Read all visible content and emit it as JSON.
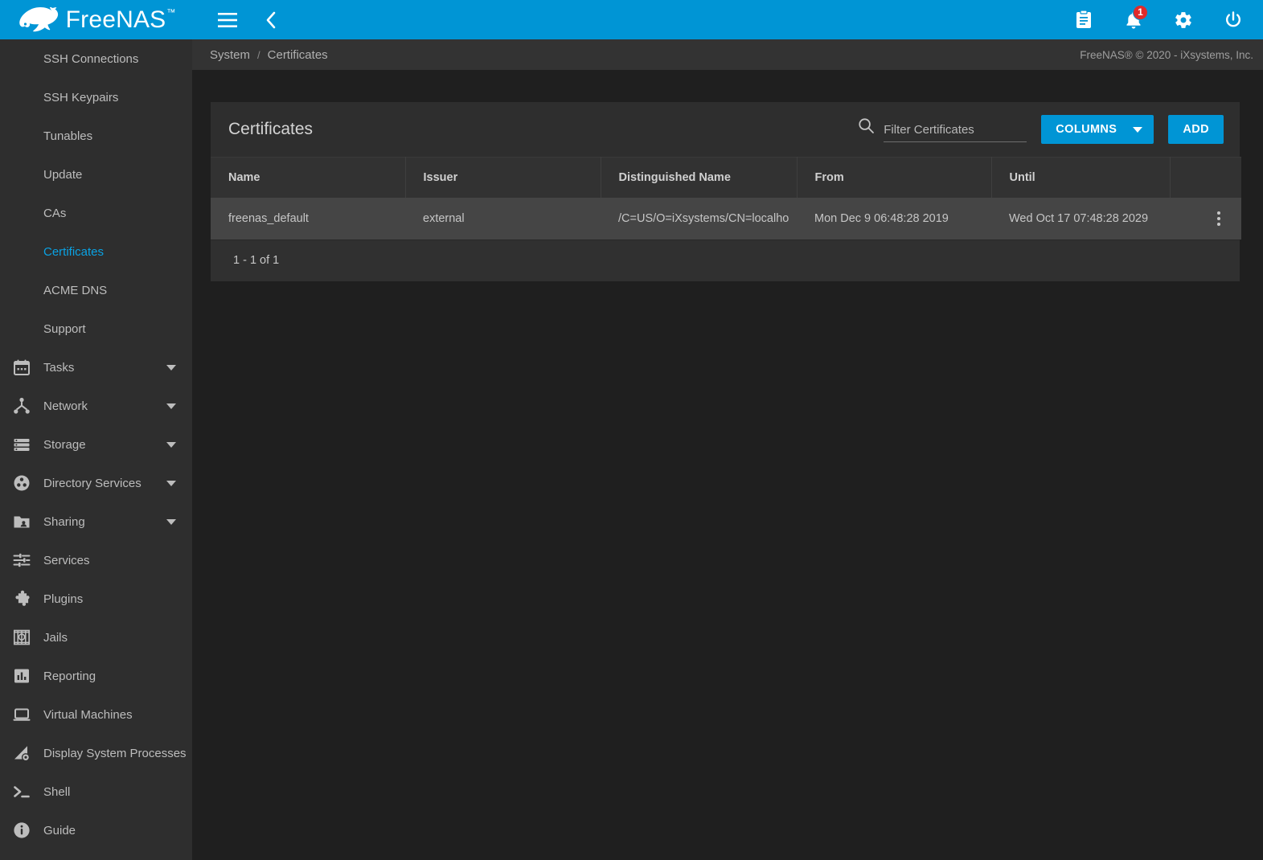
{
  "brand": {
    "name": "FreeNAS",
    "tm": "™"
  },
  "topbar": {
    "menu_icon": "hamburger-menu-icon",
    "back_icon": "chevron-left-icon",
    "icons": [
      {
        "name": "clipboard-icon",
        "label": "Tasks"
      },
      {
        "name": "bell-icon",
        "label": "Alerts",
        "badge": "1"
      },
      {
        "name": "gear-icon",
        "label": "Settings"
      },
      {
        "name": "power-icon",
        "label": "Power"
      }
    ]
  },
  "breadcrumb": {
    "root": "System",
    "separator": "/",
    "current": "Certificates"
  },
  "footer": {
    "copyright": "FreeNAS® © 2020 - iXsystems, Inc."
  },
  "sidebar": {
    "items": [
      {
        "label": "SSH Connections",
        "type": "sub",
        "active": false
      },
      {
        "label": "SSH Keypairs",
        "type": "sub",
        "active": false
      },
      {
        "label": "Tunables",
        "type": "sub",
        "active": false
      },
      {
        "label": "Update",
        "type": "sub",
        "active": false
      },
      {
        "label": "CAs",
        "type": "sub",
        "active": false
      },
      {
        "label": "Certificates",
        "type": "sub",
        "active": true
      },
      {
        "label": "ACME DNS",
        "type": "sub",
        "active": false
      },
      {
        "label": "Support",
        "type": "sub",
        "active": false
      },
      {
        "label": "Tasks",
        "type": "top",
        "icon": "calendar-icon",
        "expandable": true
      },
      {
        "label": "Network",
        "type": "top",
        "icon": "network-icon",
        "expandable": true
      },
      {
        "label": "Storage",
        "type": "top",
        "icon": "storage-icon",
        "expandable": true
      },
      {
        "label": "Directory Services",
        "type": "top",
        "icon": "directory-services-icon",
        "expandable": true
      },
      {
        "label": "Sharing",
        "type": "top",
        "icon": "folder-shared-icon",
        "expandable": true
      },
      {
        "label": "Services",
        "type": "top",
        "icon": "sliders-icon",
        "expandable": false
      },
      {
        "label": "Plugins",
        "type": "top",
        "icon": "puzzle-piece-icon",
        "expandable": false
      },
      {
        "label": "Jails",
        "type": "top",
        "icon": "jail-icon",
        "expandable": false
      },
      {
        "label": "Reporting",
        "type": "top",
        "icon": "bar-chart-icon",
        "expandable": false
      },
      {
        "label": "Virtual Machines",
        "type": "top",
        "icon": "laptop-icon",
        "expandable": false
      },
      {
        "label": "Display System Processes",
        "type": "top",
        "icon": "processes-icon",
        "expandable": false
      },
      {
        "label": "Shell",
        "type": "top",
        "icon": "terminal-icon",
        "expandable": false
      },
      {
        "label": "Guide",
        "type": "top",
        "icon": "info-circle-icon",
        "expandable": false
      }
    ]
  },
  "card": {
    "title": "Certificates",
    "search": {
      "placeholder": "Filter Certificates",
      "value": "",
      "icon": "search-icon"
    },
    "columns_button": "COLUMNS",
    "add_button": "ADD",
    "table": {
      "headers": [
        "Name",
        "Issuer",
        "Distinguished Name",
        "From",
        "Until",
        ""
      ],
      "rows": [
        {
          "name": "freenas_default",
          "issuer": "external",
          "distinguished_name": "/C=US/O=iXsystems/CN=localho",
          "from": "Mon Dec 9 06:48:28 2019",
          "until": "Wed Oct 17 07:48:28 2029",
          "menu_icon": "kebab-menu-icon"
        }
      ]
    },
    "pagination": "1 - 1 of 1"
  },
  "colors": {
    "accent": "#0095d5",
    "badge": "#e02a2a",
    "sidebar_bg": "#2e2e2e",
    "page_bg": "#1f1f1f",
    "row_hover": "#454545"
  }
}
